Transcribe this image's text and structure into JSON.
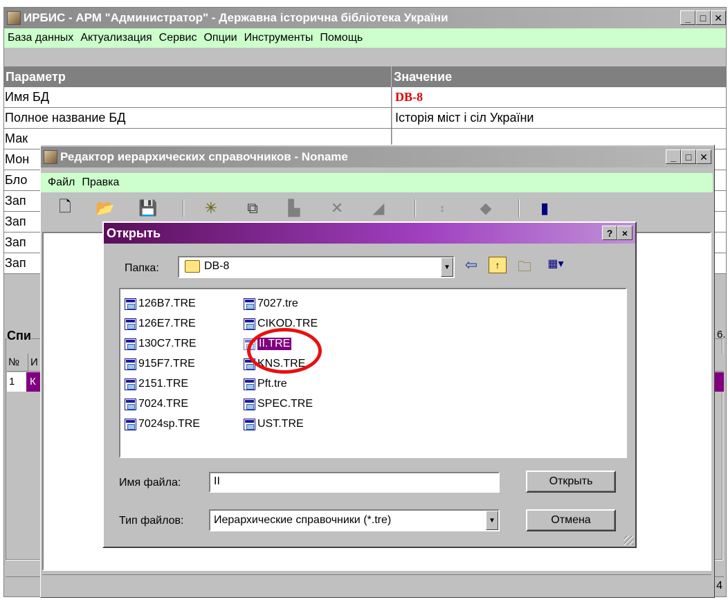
{
  "main_window": {
    "title": "ИРБИС - АРМ \"Администратор\" - Державна історична бібліотека України",
    "menu": [
      "База данных",
      "Актуализация",
      "Сервис",
      "Опции",
      "Инструменты",
      "Помощь"
    ],
    "grid_headers": {
      "param": "Параметр",
      "value": "Значение"
    },
    "rows": [
      {
        "param": "Имя БД",
        "value": "DB-8"
      },
      {
        "param": "Полное название БД",
        "value": "Історія міст і сіл України"
      },
      {
        "param": "Мак",
        "value": ""
      },
      {
        "param": "Мон",
        "value": ""
      },
      {
        "param": "Бло",
        "value": ""
      },
      {
        "param": "Зап",
        "value": ""
      },
      {
        "param": "Зап",
        "value": ""
      },
      {
        "param": "Зап",
        "value": ""
      },
      {
        "param": "Зап",
        "value": ""
      }
    ],
    "list_label": "Спи",
    "list_col_no": "№",
    "list_col_2": "И",
    "list_row_no": "1",
    "list_row_val": "К",
    "right_edge_text": "6.",
    "status_right": "4"
  },
  "editor": {
    "title": "Редактор иерархических справочников - Noname",
    "menu": [
      "Файл",
      "Правка"
    ]
  },
  "dialog": {
    "title": "Открыть",
    "help_label": "?",
    "close_label": "×",
    "folder_label": "Папка:",
    "folder_value": "DB-8",
    "files_col1": [
      "126B7.TRE",
      "126E7.TRE",
      "130C7.TRE",
      "915F7.TRE",
      "2151.TRE",
      "7024.TRE",
      "7024sp.TRE"
    ],
    "files_col2": [
      "7027.tre",
      "CIKOD.TRE",
      "II.TRE",
      "KNS.TRE",
      "Pft.tre",
      "SPEC.TRE",
      "UST.TRE"
    ],
    "selected_file": "II.TRE",
    "filename_label": "Имя файла:",
    "filename_value": "II",
    "filetype_label": "Тип файлов:",
    "filetype_value": "Иерархические справочники  (*.tre)",
    "open_button": "Открыть",
    "cancel_button": "Отмена"
  }
}
